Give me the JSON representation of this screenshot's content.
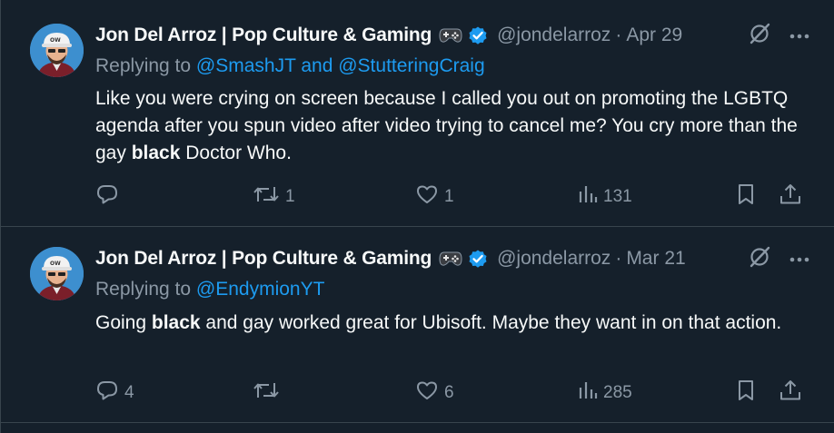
{
  "tweets": [
    {
      "author_name": "Jon Del Arroz | Pop Culture & Gaming",
      "handle": "@jondelarroz",
      "separator": "·",
      "date": "Apr 29",
      "replying_prefix": "Replying to",
      "replying_mentions": "@SmashJT and @StutteringCraig",
      "text_parts": [
        "Like you were crying on screen because I called you out on promoting the LGBTQ agenda after you spun video after video trying to cancel me? You cry more than the gay ",
        "black",
        " Doctor Who."
      ],
      "counts": {
        "replies": "",
        "reposts": "1",
        "likes": "1",
        "views": "131"
      }
    },
    {
      "author_name": "Jon Del Arroz | Pop Culture & Gaming",
      "handle": "@jondelarroz",
      "separator": "·",
      "date": "Mar 21",
      "replying_prefix": "Replying to",
      "replying_mentions": "@EndymionYT",
      "text_parts": [
        "Going ",
        "black",
        " and gay worked great for Ubisoft. Maybe they want in on that action."
      ],
      "counts": {
        "replies": "4",
        "reposts": "",
        "likes": "6",
        "views": "285"
      }
    }
  ],
  "colors": {
    "background": "#15202b",
    "text": "#f7f9f9",
    "muted": "#8b98a5",
    "accent": "#1d9bf0",
    "divider": "#38444d"
  },
  "icons": {
    "reply": "reply-icon",
    "repost": "repost-icon",
    "like": "heart-icon",
    "views": "views-icon",
    "bookmark": "bookmark-icon",
    "share": "share-icon",
    "grok": "grok-icon",
    "more": "more-icon",
    "verified": "verified-badge-icon",
    "gamepad": "gamepad-emoji-icon"
  }
}
